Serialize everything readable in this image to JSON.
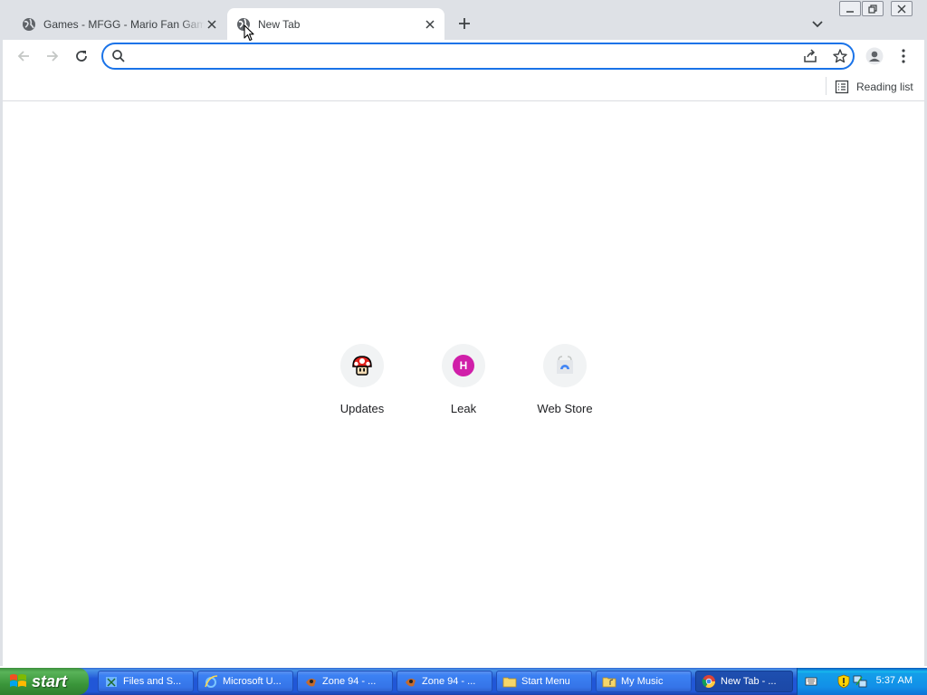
{
  "tabs": [
    {
      "title": "Games - MFGG - Mario Fan Games Galaxy",
      "active": false
    },
    {
      "title": "New Tab",
      "active": true
    }
  ],
  "omnibox": {
    "value": "",
    "placeholder": ""
  },
  "bookmarks_bar": {
    "reading_list_label": "Reading list"
  },
  "shortcuts": [
    {
      "label": "Updates",
      "icon": "mushroom-icon"
    },
    {
      "label": "Leak",
      "icon": "letter-badge",
      "letter": "H"
    },
    {
      "label": "Web Store",
      "icon": "web-store-icon"
    }
  ],
  "taskbar": {
    "start_label": "start",
    "items": [
      {
        "label": "Files and S...",
        "icon": "files-icon"
      },
      {
        "label": "Microsoft U...",
        "icon": "ie-icon"
      },
      {
        "label": "Zone 94 - ...",
        "icon": "zone-icon"
      },
      {
        "label": "Zone 94 - ...",
        "icon": "zone-icon"
      },
      {
        "label": "Start Menu",
        "icon": "folder-icon"
      },
      {
        "label": "My Music",
        "icon": "folder-icon"
      },
      {
        "label": "New Tab - ...",
        "icon": "chrome-icon",
        "active": true
      }
    ],
    "clock": "5:37 AM"
  },
  "colors": {
    "tabstrip": "#dee1e6",
    "omnibox_focus": "#1a73e8",
    "letter_badge": "#d01fa9",
    "taskbar": "#2157d7",
    "start_button": "#3a963a"
  }
}
